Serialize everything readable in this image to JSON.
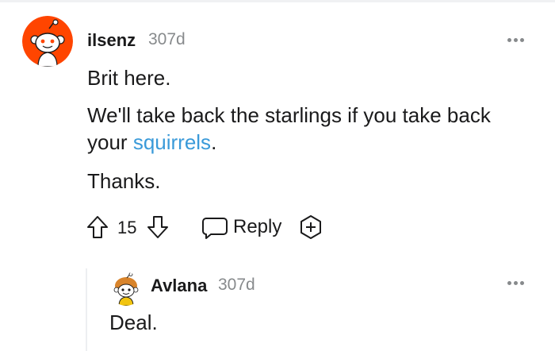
{
  "main_comment": {
    "username": "ilsenz",
    "age": "307d",
    "paragraphs": {
      "p1": "Brit here.",
      "p2_line1": "We'll take back the starlings if you take back",
      "p2_line2_prefix": "your ",
      "p2_link": "squirrels",
      "p2_line2_suffix": ".",
      "p3": "Thanks."
    },
    "score": "15",
    "reply_label": "Reply"
  },
  "reply_comment": {
    "username": "Avlana",
    "age": "307d",
    "body": "Deal."
  },
  "colors": {
    "link": "#3a9ad9",
    "muted": "#878a8c",
    "avatar_main_bg": "#ff4500",
    "thread_line": "#edeff1"
  },
  "icons": {
    "upvote": "upvote-arrow-icon",
    "downvote": "downvote-arrow-icon",
    "reply": "speech-bubble-icon",
    "award": "add-award-icon",
    "more": "more-options-icon"
  }
}
